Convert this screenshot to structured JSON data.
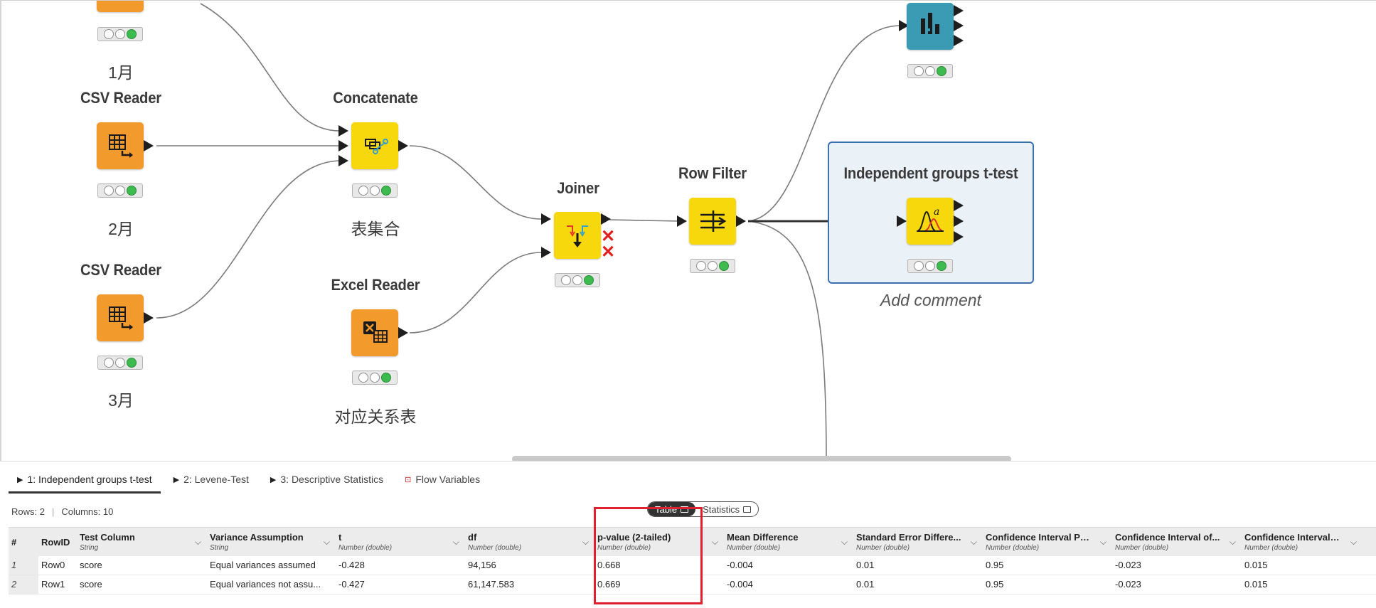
{
  "workflow": {
    "nodes": {
      "csv_reader_top": {
        "comment": "1月"
      },
      "csv_reader_2": {
        "title": "CSV Reader",
        "comment": "2月"
      },
      "csv_reader_3": {
        "title": "CSV Reader",
        "comment": "3月"
      },
      "concatenate": {
        "title": "Concatenate",
        "comment": "表集合"
      },
      "excel_reader": {
        "title": "Excel Reader",
        "comment": "对应关系表"
      },
      "joiner": {
        "title": "Joiner"
      },
      "row_filter": {
        "title": "Row Filter"
      },
      "ttest": {
        "title": "Independent groups t-test",
        "comment": "Add comment"
      }
    },
    "colors": {
      "orange": "#f39a2d",
      "yellow": "#f6d80c",
      "teal": "#3b9bb5",
      "status_green": "#3dbb4f",
      "selection_border": "#3a6fb2"
    }
  },
  "panel": {
    "tabs": [
      {
        "label": "1: Independent groups t-test",
        "active": true
      },
      {
        "label": "2: Levene-Test",
        "active": false
      },
      {
        "label": "3: Descriptive Statistics",
        "active": false
      },
      {
        "label": "Flow Variables",
        "active": false
      }
    ],
    "rows_label": "Rows: 2",
    "columns_label": "Columns: 10",
    "view_toggle": {
      "table": "Table",
      "statistics": "Statistics"
    },
    "table": {
      "columns": [
        {
          "name": "#",
          "type": ""
        },
        {
          "name": "RowID",
          "type": ""
        },
        {
          "name": "Test Column",
          "type": "String"
        },
        {
          "name": "Variance Assumption",
          "type": "String"
        },
        {
          "name": "t",
          "type": "Number (double)"
        },
        {
          "name": "df",
          "type": "Number (double)"
        },
        {
          "name": "p-value (2-tailed)",
          "type": "Number (double)"
        },
        {
          "name": "Mean Difference",
          "type": "Number (double)"
        },
        {
          "name": "Standard Error Differe...",
          "type": "Number (double)"
        },
        {
          "name": "Confidence Interval Pr...",
          "type": "Number (double)"
        },
        {
          "name": "Confidence Interval of...",
          "type": "Number (double)"
        },
        {
          "name": "Confidence Interval of...",
          "type": "Number (double)"
        }
      ],
      "rows": [
        [
          "1",
          "Row0",
          "score",
          "Equal variances assumed",
          "-0.428",
          "94,156",
          "0.668",
          "-0.004",
          "0.01",
          "0.95",
          "-0.023",
          "0.015"
        ],
        [
          "2",
          "Row1",
          "score",
          "Equal variances not assu...",
          "-0.427",
          "61,147.583",
          "0.669",
          "-0.004",
          "0.01",
          "0.95",
          "-0.023",
          "0.015"
        ]
      ]
    },
    "highlight_color": "#e0202e"
  }
}
